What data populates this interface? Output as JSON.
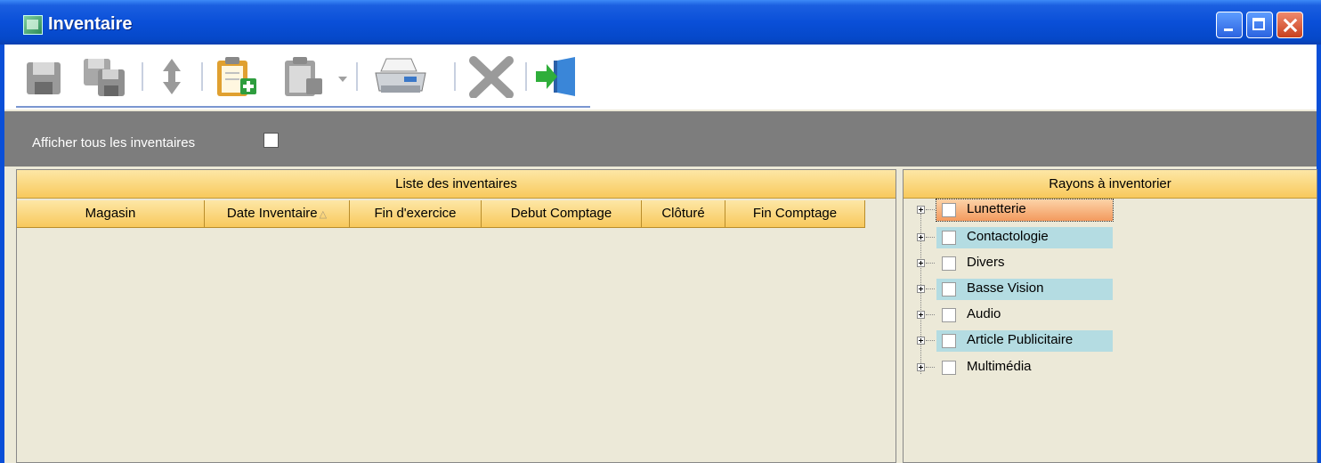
{
  "window": {
    "title": "Inventaire",
    "controls": [
      "minimize",
      "maximize",
      "close"
    ]
  },
  "toolbar": {
    "buttons": [
      {
        "icon": "save-icon",
        "enabled": false
      },
      {
        "icon": "save-all-icon",
        "enabled": false
      },
      {
        "icon": "sort-arrows-icon",
        "enabled": false
      },
      {
        "icon": "new-inventory-icon",
        "enabled": true
      },
      {
        "icon": "edit-inventory-icon",
        "enabled": false
      },
      {
        "icon": "print-icon",
        "enabled": true
      },
      {
        "icon": "delete-icon",
        "enabled": false
      },
      {
        "icon": "exit-icon",
        "enabled": true
      }
    ]
  },
  "filter": {
    "label": "Afficher tous les inventaires",
    "checked": false
  },
  "inventories": {
    "title": "Liste des inventaires",
    "columns": [
      "Magasin",
      "Date Inventaire",
      "Fin d'exercice",
      "Debut Comptage",
      "Clôturé",
      "Fin Comptage"
    ],
    "sort_column": "Date Inventaire",
    "rows": []
  },
  "rayons": {
    "title": "Rayons à inventorier",
    "items": [
      {
        "label": "Lunetterie",
        "checked": false,
        "selected": true
      },
      {
        "label": "Contactologie",
        "checked": false
      },
      {
        "label": "Divers",
        "checked": false
      },
      {
        "label": "Basse Vision",
        "checked": false
      },
      {
        "label": "Audio",
        "checked": false
      },
      {
        "label": "Article Publicitaire",
        "checked": false
      },
      {
        "label": "Multimédia",
        "checked": false
      }
    ]
  },
  "colors": {
    "titlebar": "#0a4fd8",
    "header_gold": "#f8c95c",
    "filterbar": "#7d7d7d",
    "tree_highlight": "#b4dce2",
    "selected_highlight": "#f7b07a"
  }
}
